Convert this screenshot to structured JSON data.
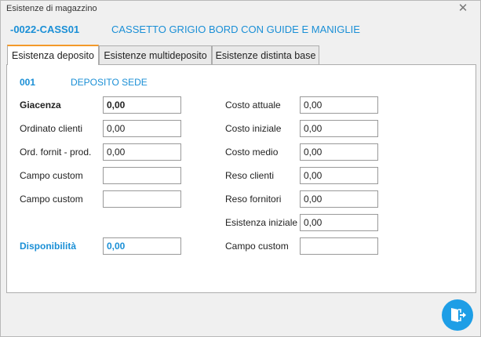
{
  "window": {
    "title": "Esistenze di magazzino"
  },
  "item": {
    "code": "-0022-CASS01",
    "description": "CASSETTO GRIGIO BORD CON GUIDE E MANIGLIE"
  },
  "tabs": [
    {
      "label": "Esistenza deposito",
      "active": true
    },
    {
      "label": "Esistenze multideposito",
      "active": false
    },
    {
      "label": "Esistenze distinta base",
      "active": false
    }
  ],
  "deposit": {
    "code": "001",
    "name": "DEPOSITO SEDE"
  },
  "left": [
    {
      "label": "Giacenza",
      "value": "0,00"
    },
    {
      "label": "Ordinato clienti",
      "value": "0,00"
    },
    {
      "label": "Ord. fornit - prod.",
      "value": "0,00"
    },
    {
      "label": "Campo custom",
      "value": ""
    },
    {
      "label": "Campo custom",
      "value": ""
    }
  ],
  "availability": {
    "label": "Disponibilità",
    "value": "0,00"
  },
  "right": [
    {
      "label": "Costo attuale",
      "value": "0,00"
    },
    {
      "label": "Costo iniziale",
      "value": "0,00"
    },
    {
      "label": "Costo medio",
      "value": "0,00"
    },
    {
      "label": "Reso clienti",
      "value": "0,00"
    },
    {
      "label": "Reso fornitori",
      "value": "0,00"
    },
    {
      "label": "Esistenza iniziale",
      "value": "0,00"
    },
    {
      "label": "Campo custom",
      "value": ""
    }
  ],
  "icons": {
    "close": "close-icon",
    "exit": "exit-door-icon"
  },
  "colors": {
    "accent": "#1a8fd6",
    "tab_active": "#f39a2a",
    "button": "#1e9ee6"
  }
}
